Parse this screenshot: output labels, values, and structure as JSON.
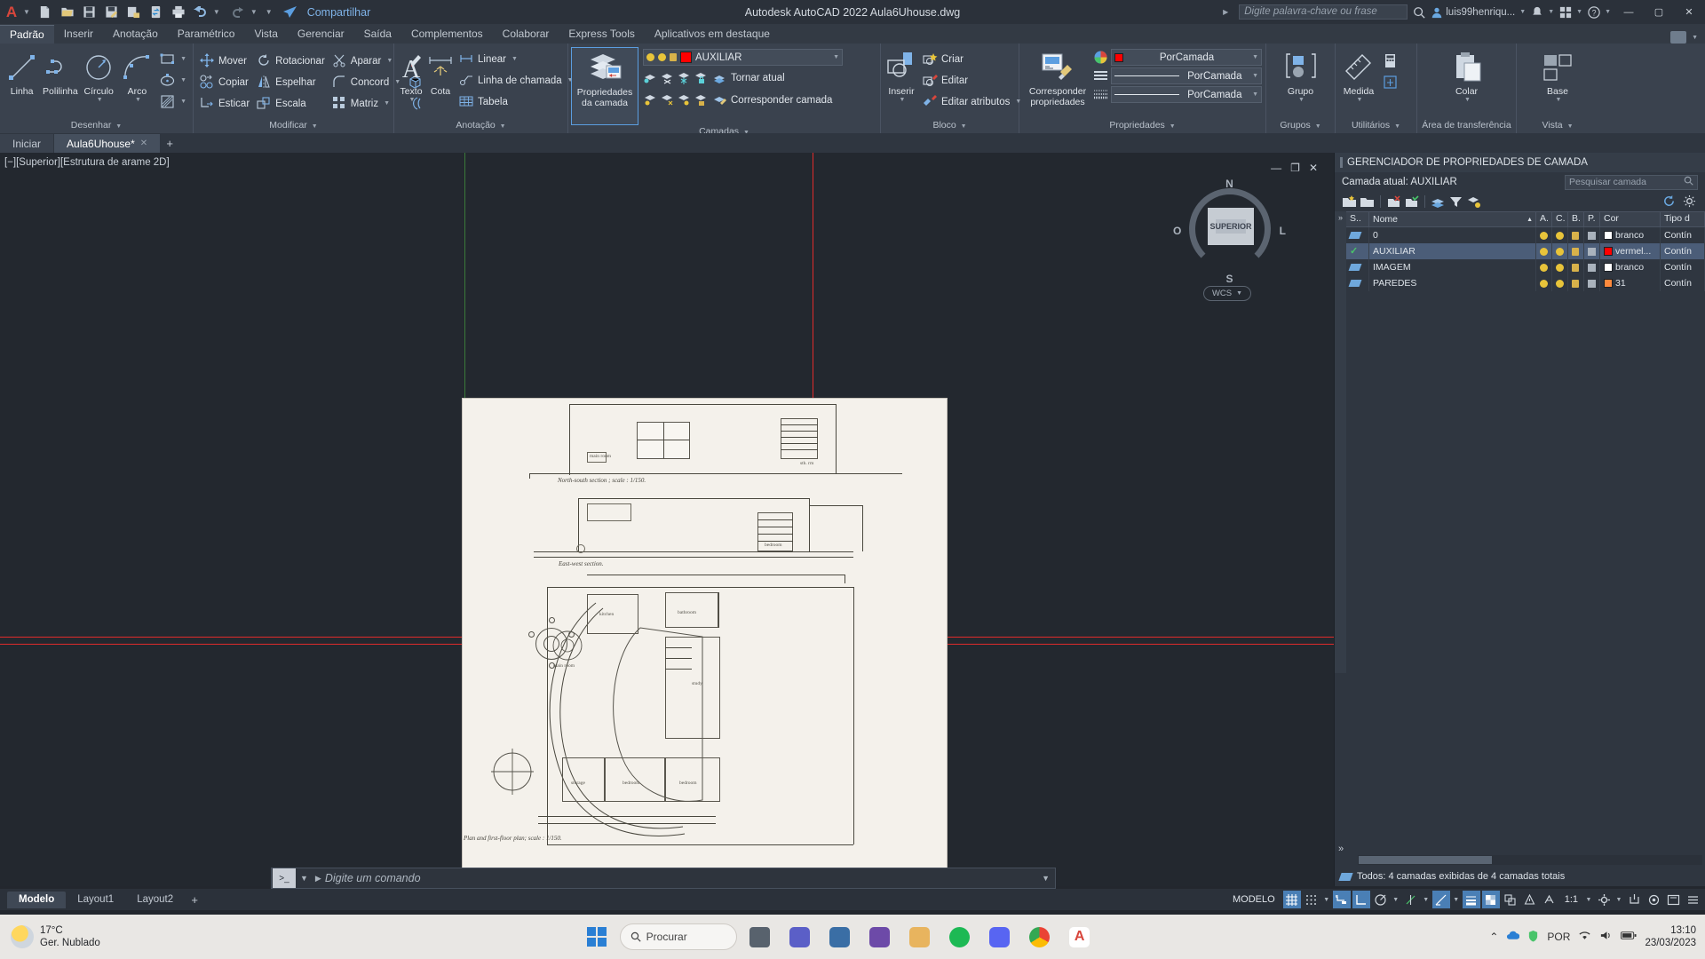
{
  "titlebar": {
    "logo": "A",
    "quick_access": [
      "new-file",
      "open-file",
      "save",
      "save-as",
      "plot-preview",
      "sync",
      "print",
      "undo",
      "redo",
      "customize"
    ],
    "share_label": "Compartilhar",
    "app_title": "Autodesk AutoCAD 2022    Aula6Uhouse.dwg",
    "search_placeholder": "Digite palavra-chave ou frase",
    "user_name": "luis99henriqu...",
    "window_buttons": [
      "minimize",
      "maximize",
      "close"
    ]
  },
  "ribbon_tabs": [
    {
      "label": "Padrão",
      "active": true
    },
    {
      "label": "Inserir",
      "active": false
    },
    {
      "label": "Anotação",
      "active": false
    },
    {
      "label": "Paramétrico",
      "active": false
    },
    {
      "label": "Vista",
      "active": false
    },
    {
      "label": "Gerenciar",
      "active": false
    },
    {
      "label": "Saída",
      "active": false
    },
    {
      "label": "Complementos",
      "active": false
    },
    {
      "label": "Colaborar",
      "active": false
    },
    {
      "label": "Express Tools",
      "active": false
    },
    {
      "label": "Aplicativos em destaque",
      "active": false
    }
  ],
  "ribbon": {
    "desenhar": {
      "title": "Desenhar",
      "big": [
        {
          "label": "Linha",
          "icon": "line-icon"
        },
        {
          "label": "Polilinha",
          "icon": "polyline-icon"
        },
        {
          "label": "Círculo",
          "icon": "circle-icon"
        },
        {
          "label": "Arco",
          "icon": "arc-icon"
        }
      ],
      "small": [
        {
          "label": "",
          "icon": "rectangle-icon"
        },
        {
          "label": "",
          "icon": "ellipse-icon"
        },
        {
          "label": "",
          "icon": "hatch-icon"
        }
      ]
    },
    "modificar": {
      "title": "Modificar",
      "col1": [
        {
          "label": "Mover",
          "icon": "move-icon"
        },
        {
          "label": "Copiar",
          "icon": "copy-icon"
        },
        {
          "label": "Esticar",
          "icon": "stretch-icon"
        }
      ],
      "col2": [
        {
          "label": "Rotacionar",
          "icon": "rotate-icon"
        },
        {
          "label": "Espelhar",
          "icon": "mirror-icon"
        },
        {
          "label": "Escala",
          "icon": "scale-icon"
        }
      ],
      "col3": [
        {
          "label": "Aparar",
          "icon": "trim-icon"
        },
        {
          "label": "Concord",
          "icon": "fillet-icon"
        },
        {
          "label": "Matriz",
          "icon": "array-icon"
        }
      ],
      "col4": [
        {
          "label": "",
          "icon": "erase-icon"
        },
        {
          "label": "",
          "icon": "3d-box-icon"
        },
        {
          "label": "",
          "icon": "offset-icon"
        }
      ]
    },
    "anotacao": {
      "title": "Anotação",
      "big": [
        {
          "label": "Texto",
          "icon": "text-icon"
        },
        {
          "label": "Cota",
          "icon": "dimension-icon"
        }
      ],
      "small": [
        {
          "label": "Linear",
          "icon": "linear-dim-icon"
        },
        {
          "label": "Linha de chamada",
          "icon": "leader-icon"
        },
        {
          "label": "Tabela",
          "icon": "table-icon"
        }
      ]
    },
    "camadas": {
      "title": "Camadas",
      "big_label_1": "Propriedades",
      "big_label_2": "da camada",
      "current_layer": "AUXILIAR",
      "current_layer_color": "#ff0000",
      "actions": [
        {
          "label": "Tornar atual",
          "icon": "layer-make-current-icon"
        },
        {
          "label": "Corresponder camada",
          "icon": "layer-match-icon"
        }
      ]
    },
    "bloco": {
      "title": "Bloco",
      "big_label": "Inserir",
      "items": [
        {
          "label": "Criar",
          "icon": "block-create-icon"
        },
        {
          "label": "Editar",
          "icon": "block-edit-icon"
        },
        {
          "label": "Editar atributos",
          "icon": "block-attrib-icon"
        }
      ]
    },
    "propriedades": {
      "title": "Propriedades",
      "big_label_1": "Corresponder",
      "big_label_2": "propriedades",
      "color": "PorCamada",
      "color_swatch": "#ff0000",
      "linetype": "PorCamada",
      "lineweight": "PorCamada"
    },
    "grupos": {
      "title": "Grupos",
      "big_label": "Grupo"
    },
    "utilitarios": {
      "title": "Utilitários",
      "big_label": "Medida"
    },
    "transferencia": {
      "title": "Área de transferência",
      "big_label": "Colar"
    },
    "vista": {
      "title": "Vista",
      "big_label": "Base"
    }
  },
  "doctabs": [
    {
      "label": "Iniciar",
      "active": false,
      "closable": false
    },
    {
      "label": "Aula6Uhouse*",
      "active": true,
      "closable": true
    }
  ],
  "viewport": {
    "label": "[−][Superior][Estrutura de arame 2D]",
    "controls": [
      "minimize",
      "restore",
      "close"
    ],
    "viewcube": {
      "face": "SUPERIOR",
      "n": "N",
      "s": "S",
      "o": "O",
      "l": "L",
      "wcs": "WCS"
    },
    "drawing": {
      "caption_section_ns": "North-south section ; scale :  1/150.",
      "caption_section_ew": "East-west section.",
      "caption_plan": "Plan and first-floor plan; scale :  1/150.",
      "rooms": [
        "main room",
        "study",
        "kitchen",
        "bathroom",
        "storage",
        "bedroom",
        "bedroom",
        "main room"
      ]
    }
  },
  "command_line": {
    "placeholder": "Digite um comando",
    "icons": [
      "grip",
      "close-icon",
      "wrench-icon",
      "console-icon"
    ]
  },
  "layout_tabs": [
    {
      "label": "Modelo",
      "active": true
    },
    {
      "label": "Layout1",
      "active": false
    },
    {
      "label": "Layout2",
      "active": false
    }
  ],
  "statusbar": {
    "model_label": "MODELO",
    "scale": "1:1",
    "toggles": [
      "grid",
      "snap",
      "ortho-dropdown",
      "infer-constraints",
      "ortho",
      "polar",
      "otrack",
      "osnap",
      "lineweight",
      "transparency",
      "selection-cycling",
      "annotation",
      "workspace",
      "customize"
    ]
  },
  "layer_manager": {
    "title": "GERENCIADOR DE PROPRIEDADES DE CAMADA",
    "current_layer_label": "Camada atual: AUXILIAR",
    "search_placeholder": "Pesquisar camada",
    "columns": [
      "S..",
      "Nome",
      "A.",
      "C.",
      "B.",
      "P.",
      "Cor",
      "Tipo d"
    ],
    "rows": [
      {
        "status": "layer",
        "name": "0",
        "on": "bulb",
        "freeze": "sun",
        "lock": "unlocked",
        "plot": "plot",
        "color_name": "branco",
        "color_hex": "#ffffff",
        "linetype": "Contín"
      },
      {
        "status": "current",
        "name": "AUXILIAR",
        "on": "bulb",
        "freeze": "sun",
        "lock": "unlocked",
        "plot": "plot",
        "color_name": "vermel...",
        "color_hex": "#ff0000",
        "linetype": "Contín",
        "selected": true
      },
      {
        "status": "layer",
        "name": "IMAGEM",
        "on": "bulb",
        "freeze": "sun",
        "lock": "unlocked",
        "plot": "plot",
        "color_name": "branco",
        "color_hex": "#ffffff",
        "linetype": "Contín"
      },
      {
        "status": "layer",
        "name": "PAREDES",
        "on": "bulb",
        "freeze": "sun",
        "lock": "unlocked",
        "plot": "plot",
        "color_name": "31",
        "color_hex": "#ff8a3d",
        "linetype": "Contín"
      }
    ],
    "footer": "Todos: 4 camadas exibidas de 4 camadas totais",
    "toolbar_icons": [
      "new-layer-icon",
      "new-layer-vp-icon",
      "delete-layer-icon",
      "set-current-icon",
      "layer-states-icon",
      "filter-icon",
      "refresh-icon",
      "settings-icon"
    ]
  },
  "taskbar": {
    "weather_temp": "17°C",
    "weather_desc": "Ger. Nublado",
    "search_label": "Procurar",
    "apps": [
      "start",
      "search",
      "task-view",
      "widgets",
      "teams",
      "store",
      "notepad",
      "explorer",
      "spotify",
      "discord",
      "chrome",
      "autocad"
    ],
    "tray": [
      "chevron-up",
      "onedrive",
      "security",
      "language",
      "wifi",
      "volume",
      "battery"
    ],
    "language": "POR",
    "time": "13:10",
    "date": "23/03/2023"
  },
  "colors": {
    "accent_red": "#ff0000",
    "ribbon_bg": "#3a424e",
    "canvas_bg": "#23282f",
    "highlight": "#4b5d78"
  }
}
